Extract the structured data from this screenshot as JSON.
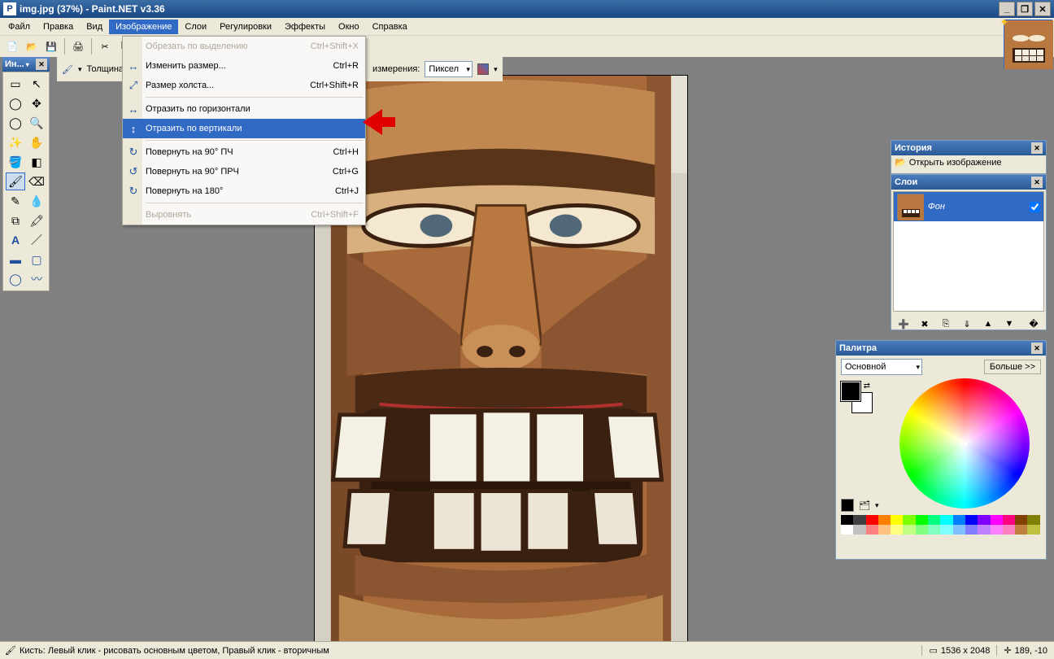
{
  "titlebar": {
    "title": "img.jpg (37%) - Paint.NET v3.36"
  },
  "window_buttons": {
    "min": "_",
    "max": "❐",
    "close": "✕"
  },
  "menubar": [
    "Файл",
    "Правка",
    "Вид",
    "Изображение",
    "Слои",
    "Регулировки",
    "Эффекты",
    "Окно",
    "Справка"
  ],
  "active_menu_index": 3,
  "toolbar2": {
    "thickness_label": "Толщина",
    "unit_label": "измерения:",
    "unit_value": "Пиксел"
  },
  "toolpalette": {
    "title": "Ин..."
  },
  "dropdown_items": [
    {
      "icon": "",
      "label": "Обрезать по выделению",
      "shortcut": "Ctrl+Shift+X",
      "disabled": true
    },
    {
      "icon": "↔",
      "label": "Изменить размер...",
      "shortcut": "Ctrl+R"
    },
    {
      "icon": "⤢",
      "label": "Размер холста...",
      "shortcut": "Ctrl+Shift+R"
    },
    {
      "sep": true
    },
    {
      "icon": "↔",
      "label": "Отразить по горизонтали",
      "shortcut": ""
    },
    {
      "icon": "↕",
      "label": "Отразить по вертикали",
      "shortcut": "",
      "hover": true
    },
    {
      "sep": true
    },
    {
      "icon": "↻",
      "label": "Повернуть на 90° ПЧ",
      "shortcut": "Ctrl+H"
    },
    {
      "icon": "↺",
      "label": "Повернуть на 90° ПРЧ",
      "shortcut": "Ctrl+G"
    },
    {
      "icon": "↻",
      "label": "Повернуть на 180°",
      "shortcut": "Ctrl+J"
    },
    {
      "sep": true
    },
    {
      "icon": "",
      "label": "Выровнять",
      "shortcut": "Ctrl+Shift+F",
      "disabled": true
    }
  ],
  "history_panel": {
    "title": "История",
    "item_label": "Открыть изображение"
  },
  "layers_panel": {
    "title": "Слои",
    "layer_name": "Фон"
  },
  "palette_panel": {
    "title": "Палитра",
    "mode": "Основной",
    "more": "Больше >>"
  },
  "palette_colors_row1": [
    "#000000",
    "#404040",
    "#ff0000",
    "#ff8000",
    "#ffff00",
    "#80ff00",
    "#00ff00",
    "#00ff80",
    "#00ffff",
    "#0080ff",
    "#0000ff",
    "#8000ff",
    "#ff00ff",
    "#ff0080",
    "#804000",
    "#808000"
  ],
  "palette_colors_row2": [
    "#ffffff",
    "#c0c0c0",
    "#ff8080",
    "#ffc080",
    "#ffff80",
    "#c0ff80",
    "#80ff80",
    "#80ffc0",
    "#80ffff",
    "#80c0ff",
    "#8080ff",
    "#c080ff",
    "#ff80ff",
    "#ff80c0",
    "#c08040",
    "#c0c040"
  ],
  "statusbar": {
    "left_text": "Кисть: Левый клик - рисовать основным цветом, Правый клик - вторичным",
    "dims": "1536 x 2048",
    "coords": "189, -10"
  }
}
